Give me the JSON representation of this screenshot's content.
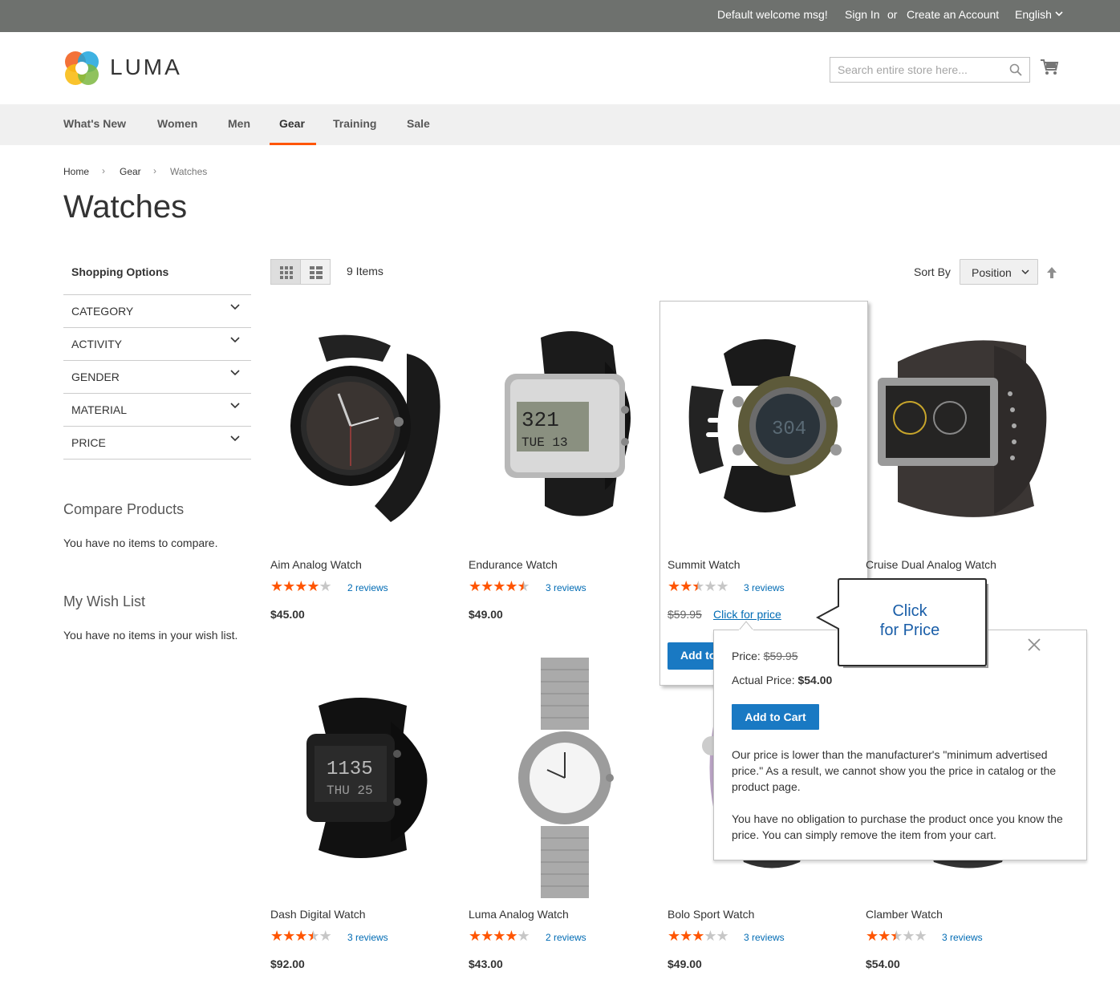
{
  "header": {
    "welcome": "Default welcome msg!",
    "sign_in": "Sign In",
    "or": "or",
    "create_account": "Create an Account",
    "language": "English",
    "logo_text": "LUMA",
    "search_placeholder": "Search entire store here..."
  },
  "nav": {
    "items": [
      "What's New",
      "Women",
      "Men",
      "Gear",
      "Training",
      "Sale"
    ],
    "active": "Gear"
  },
  "breadcrumb": [
    "Home",
    "Gear",
    "Watches"
  ],
  "page_title": "Watches",
  "sidebar": {
    "shopping_options": "Shopping Options",
    "filters": [
      "CATEGORY",
      "ACTIVITY",
      "GENDER",
      "MATERIAL",
      "PRICE"
    ],
    "compare_title": "Compare Products",
    "compare_text": "You have no items to compare.",
    "wishlist_title": "My Wish List",
    "wishlist_text": "You have no items in your wish list."
  },
  "toolbar": {
    "items_count": "9 Items",
    "sort_label": "Sort By",
    "sort_value": "Position"
  },
  "products": [
    {
      "name": "Aim Analog Watch",
      "rating": 4,
      "reviews": "2 reviews",
      "price": "$45.00"
    },
    {
      "name": "Endurance Watch",
      "rating": 4.5,
      "reviews": "3 reviews",
      "price": "$49.00"
    },
    {
      "name": "Summit Watch",
      "rating": 2.5,
      "reviews": "3 reviews",
      "old_price": "$59.95",
      "link": "Click for price",
      "add_label": "Add to Cart"
    },
    {
      "name": "Cruise Dual Analog Watch",
      "rating": null,
      "reviews": "",
      "price": ""
    },
    {
      "name": "Dash Digital Watch",
      "rating": 3.5,
      "reviews": "3 reviews",
      "price": "$92.00"
    },
    {
      "name": "Luma Analog Watch",
      "rating": 4,
      "reviews": "2 reviews",
      "price": "$43.00"
    },
    {
      "name": "Bolo Sport Watch",
      "rating": 3,
      "reviews": "3 reviews",
      "price": "$49.00"
    },
    {
      "name": "Clamber Watch",
      "rating": 2.5,
      "reviews": "3 reviews",
      "price": "$54.00"
    }
  ],
  "popup": {
    "price_label": "Price:",
    "price_old": "$59.95",
    "actual_label": "Actual Price:",
    "actual_value": "$54.00",
    "button": "Add to Cart",
    "p1": "Our price is lower than the manufacturer's \"minimum advertised price.\" As a result, we cannot show you the price in catalog or the product page.",
    "p2": "You have no obligation to purchase the product once you know the price. You can simply remove the item from your cart."
  },
  "callout": {
    "line1": "Click",
    "line2": "for Price"
  },
  "colors": {
    "accent": "#ff5501",
    "button": "#1979c3",
    "link": "#006bb4",
    "top_bar": "#6e716e"
  }
}
